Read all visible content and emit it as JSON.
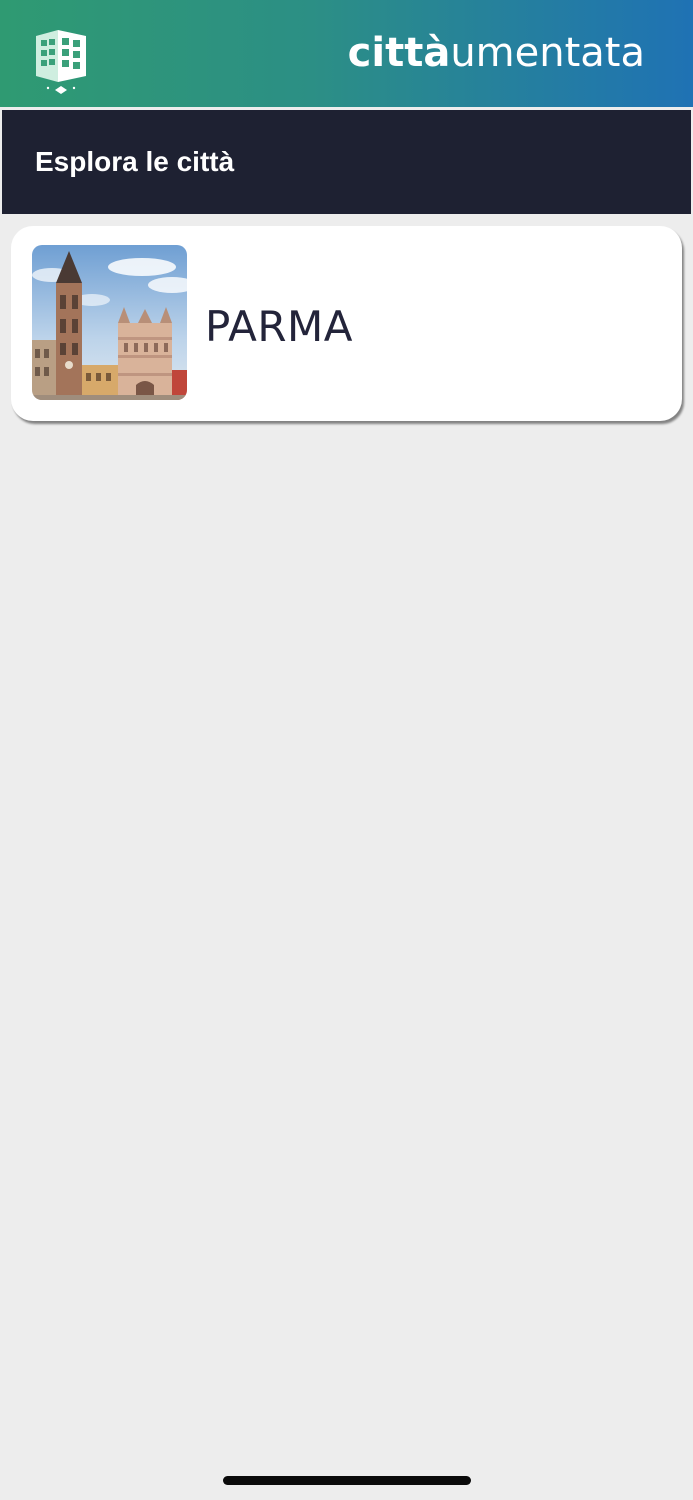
{
  "header": {
    "brand_bold": "città",
    "brand_light": "umentata",
    "logo_icon": "building-logo-icon",
    "colors": {
      "gradient_start": "#2f9a72",
      "gradient_end": "#1f72b4"
    }
  },
  "section": {
    "title": "Esplora le città",
    "background": "#1e2132"
  },
  "cities": [
    {
      "name": "PARMA",
      "image": "parma-cathedral-baptistery-photo"
    }
  ]
}
